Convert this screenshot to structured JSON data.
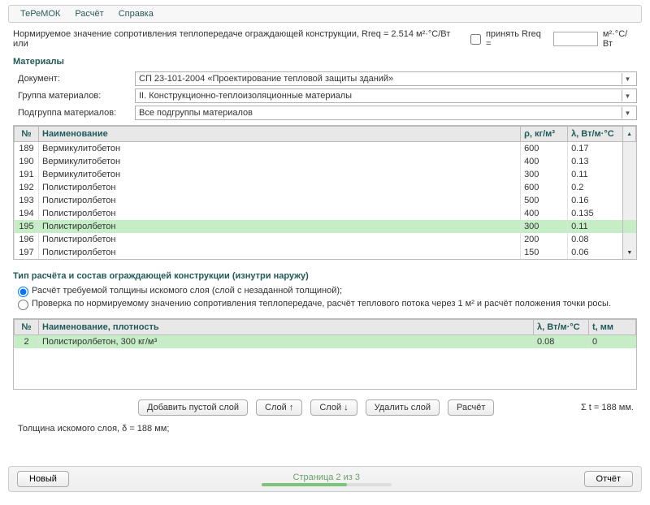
{
  "menu": {
    "item1": "ТеРеМОК",
    "item2": "Расчёт",
    "item3": "Справка"
  },
  "rreq": {
    "text_a": "Нормируемое значение сопротивления теплопередаче ограждающей конструкции, Rreq = 2.514 м²·°С/Вт или",
    "checkbox_label": "принять Rreq =",
    "unit": "м²·°С/Вт",
    "value": ""
  },
  "materials": {
    "title": "Материалы",
    "label_doc": "Документ:",
    "label_group": "Группа материалов:",
    "label_subgroup": "Подгруппа материалов:",
    "doc": "СП 23-101-2004 «Проектирование тепловой защиты зданий»",
    "group": "II. Конструкционно-теплоизоляционные материалы",
    "subgroup": "Все подгруппы материалов"
  },
  "table1": {
    "headers": {
      "num": "№",
      "name": "Наименование",
      "rho": "ρ, кг/м³",
      "lambda": "λ, Вт/м·°С"
    },
    "rows": [
      {
        "num": "189",
        "name": "Вермикулитобетон",
        "rho": "600",
        "lambda": "0.17"
      },
      {
        "num": "190",
        "name": "Вермикулитобетон",
        "rho": "400",
        "lambda": "0.13"
      },
      {
        "num": "191",
        "name": "Вермикулитобетон",
        "rho": "300",
        "lambda": "0.11"
      },
      {
        "num": "192",
        "name": "Полистиролбетон",
        "rho": "600",
        "lambda": "0.2"
      },
      {
        "num": "193",
        "name": "Полистиролбетон",
        "rho": "500",
        "lambda": "0.16"
      },
      {
        "num": "194",
        "name": "Полистиролбетон",
        "rho": "400",
        "lambda": "0.135"
      },
      {
        "num": "195",
        "name": "Полистиролбетон",
        "rho": "300",
        "lambda": "0.11",
        "selected": true
      },
      {
        "num": "196",
        "name": "Полистиролбетон",
        "rho": "200",
        "lambda": "0.08"
      },
      {
        "num": "197",
        "name": "Полистиролбетон",
        "rho": "150",
        "lambda": "0.06"
      }
    ]
  },
  "calc_section": {
    "title": "Тип расчёта и состав ограждающей конструкции (изнутри наружу)",
    "radio1": "Расчёт требуемой толщины искомого слоя (слой с незаданной толщиной);",
    "radio2": "Проверка по нормируемому значению сопротивления теплопередаче, расчёт теплового потока через 1 м² и расчёт положения точки росы."
  },
  "table2": {
    "headers": {
      "num": "№",
      "name": "Наименование, плотность",
      "lambda": "λ, Вт/м·°С",
      "t": "t, мм"
    },
    "rows": [
      {
        "num": "2",
        "name": "Полистиролбетон, 300 кг/м³",
        "lambda": "0.08",
        "t": "0",
        "selected": true
      }
    ]
  },
  "buttons": {
    "add": "Добавить пустой слой",
    "up": "Слой ↑",
    "down": "Слой ↓",
    "del": "Удалить слой",
    "calc": "Расчёт"
  },
  "sigma": "Σ t = 188 мм.",
  "result": "Толщина искомого слоя, δ = 188 мм;",
  "footer": {
    "new": "Новый",
    "page": "Страница 2 из 3",
    "report": "Отчёт"
  }
}
